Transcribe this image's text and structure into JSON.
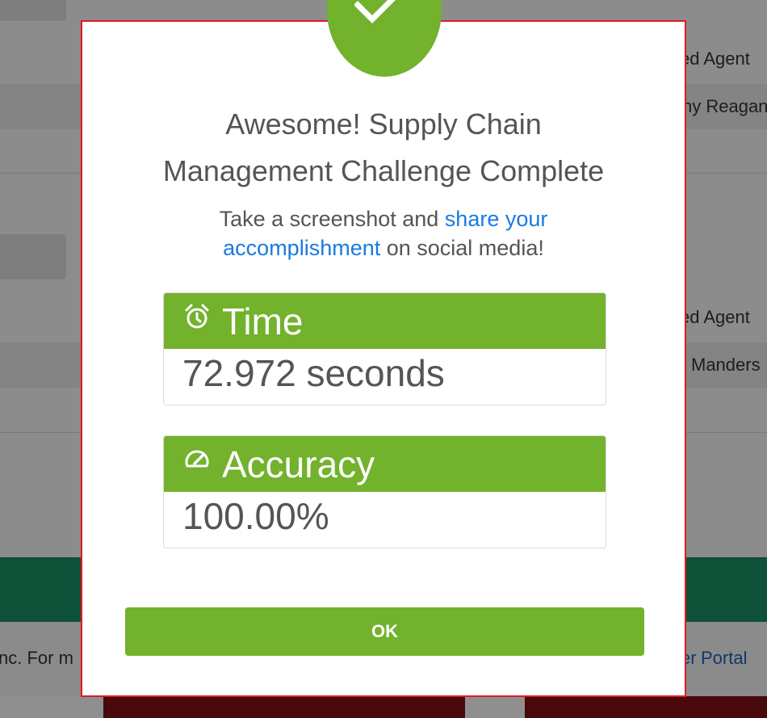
{
  "background": {
    "right_labels": [
      "ed Agent",
      "ny Reagan",
      "ed Agent",
      "Manders"
    ],
    "footer_left_text": "nc. For m",
    "footer_link_prefix": "er",
    "footer_link_text": "Portal"
  },
  "modal": {
    "title_line1": "Awesome! Supply Chain",
    "title_line2": "Management Challenge Complete",
    "subtitle_before": "Take a screenshot and ",
    "subtitle_link_line1": "share your",
    "subtitle_link_line2": "accomplishment",
    "subtitle_after": " on social media!",
    "time": {
      "label": "Time",
      "value": "72.972 seconds",
      "icon": "alarm-clock-icon"
    },
    "accuracy": {
      "label": "Accuracy",
      "value": "100.00%",
      "icon": "speedometer-icon"
    },
    "ok_label": "OK"
  },
  "colors": {
    "accent_green": "#72b22c",
    "link_blue": "#1a7ae0",
    "modal_border": "#e01b24",
    "text_gray": "#555555"
  }
}
